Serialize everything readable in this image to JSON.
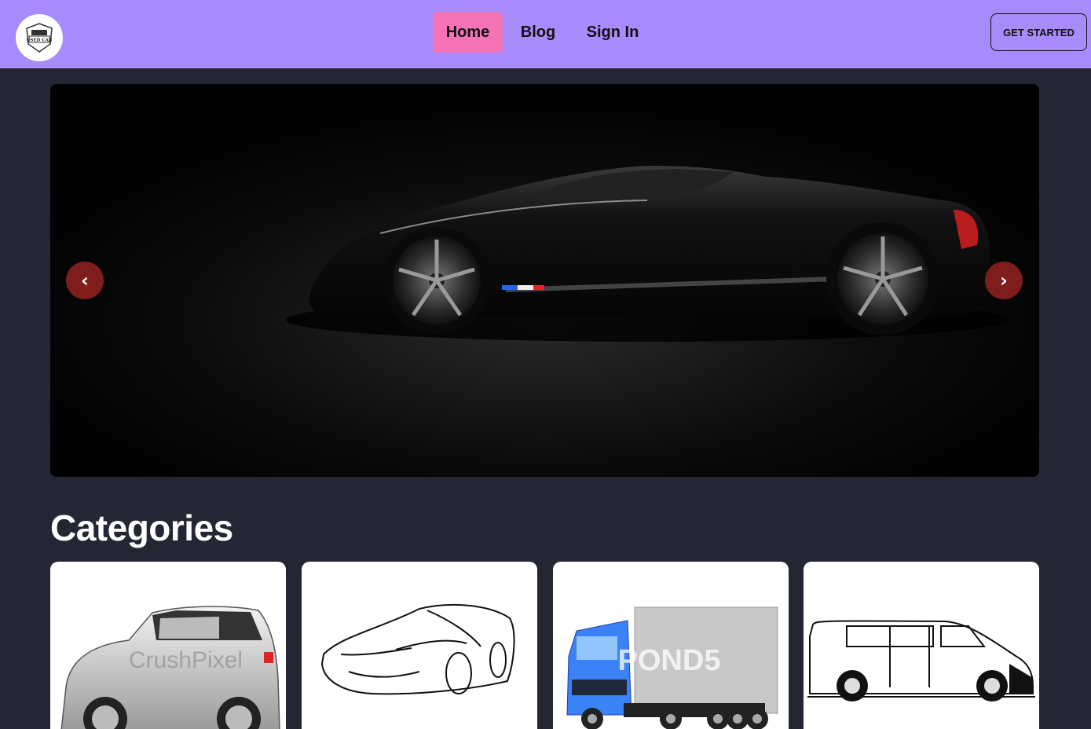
{
  "brand": {
    "logo_text": "USED CAR"
  },
  "nav": {
    "links": [
      {
        "label": "Home",
        "active": true
      },
      {
        "label": "Blog",
        "active": false
      },
      {
        "label": "Sign In",
        "active": false
      }
    ],
    "cta_label": "GET STARTED"
  },
  "hero": {
    "prev_label": "‹",
    "next_label": "›"
  },
  "categories": {
    "title": "Categories",
    "items": [
      {
        "name": "hatchback",
        "watermark": "CrushPixel"
      },
      {
        "name": "sports-car"
      },
      {
        "name": "truck",
        "watermark": "POND5"
      },
      {
        "name": "van"
      }
    ]
  },
  "colors": {
    "navbar": "#a78bfa",
    "active_link": "#f472b6",
    "page_bg": "#242633",
    "arrow_bg": "#7f1d1d"
  }
}
